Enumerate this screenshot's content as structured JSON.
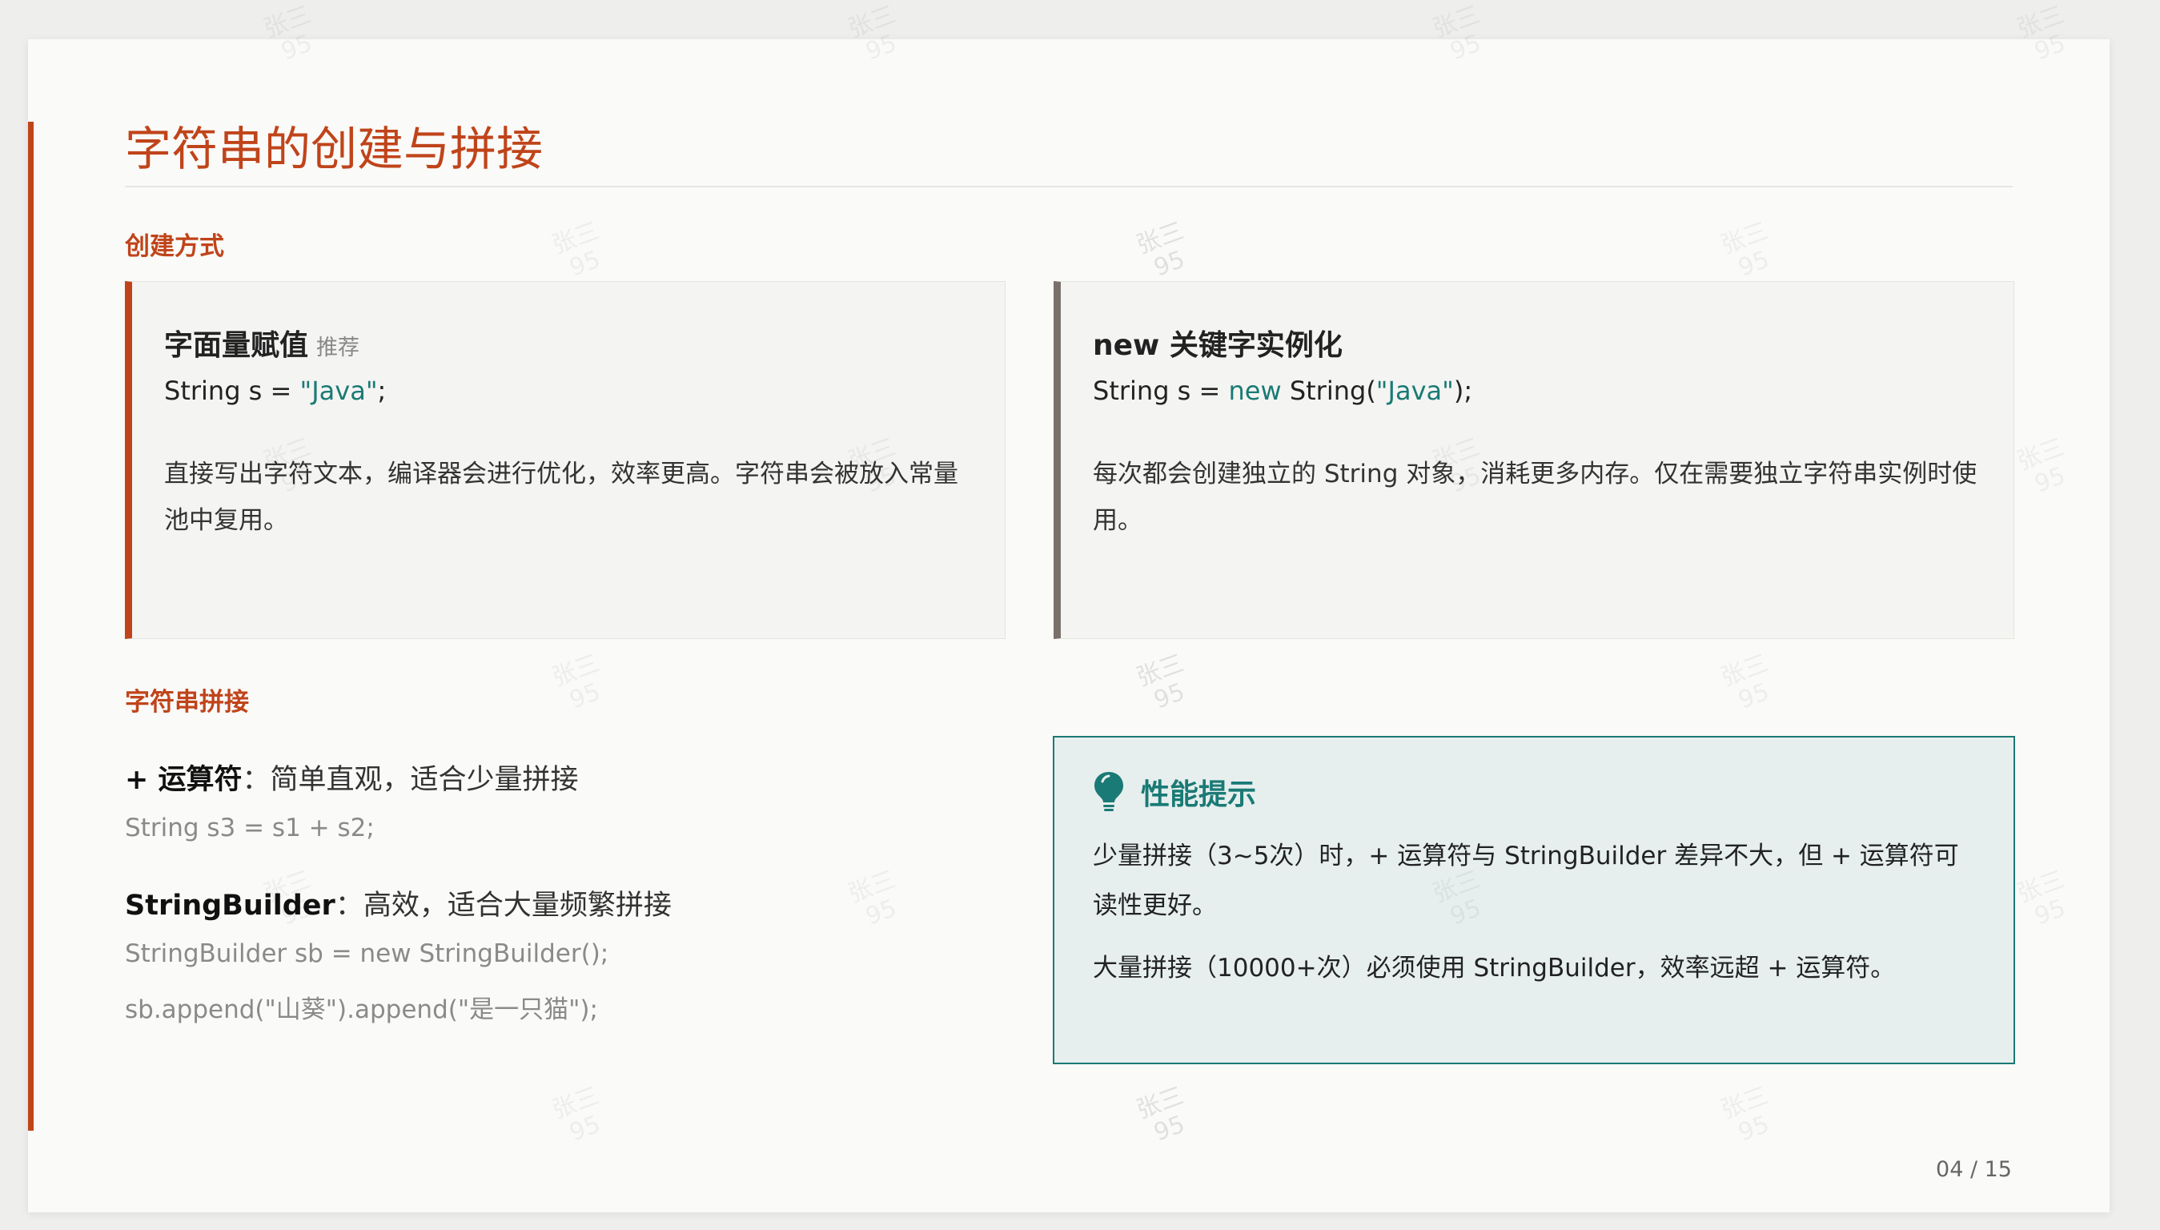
{
  "slide": {
    "title": "字符串的创建与拼接",
    "creation_heading": "创建方式",
    "cards": [
      {
        "title": "字面量赋值",
        "tag": "推荐",
        "code_prefix": "String s = ",
        "code_keyword": "",
        "code_middle": "",
        "code_string": "\"Java\"",
        "code_suffix": ";",
        "description": "直接写出字符文本，编译器会进行优化，效率更高。字符串会被放入常量池中复用。"
      },
      {
        "title": "new 关键字实例化",
        "tag": "",
        "code_prefix": "String s = ",
        "code_keyword": "new",
        "code_middle": " String(",
        "code_string": "\"Java\"",
        "code_suffix": ");",
        "description": "每次都会创建独立的 String 对象，消耗更多内存。仅在需要独立字符串实例时使用。"
      }
    ],
    "concat_heading": "字符串拼接",
    "concat_items": [
      {
        "label": "+ 运算符",
        "text": "：简单直观，适合少量拼接",
        "code": [
          "String s3 = s1 + s2;"
        ]
      },
      {
        "label": "StringBuilder",
        "text": "：高效，适合大量频繁拼接",
        "code": [
          "StringBuilder sb = new StringBuilder();",
          "sb.append(\"山葵\").append(\"是一只猫\");"
        ]
      }
    ],
    "tip": {
      "icon": "lightbulb-icon",
      "title": "性能提示",
      "paragraphs": [
        "少量拼接（3~5次）时，+ 运算符与 StringBuilder 差异不大，但 + 运算符可读性更好。",
        "大量拼接（10000+次）必须使用 StringBuilder，效率远超 + 运算符。"
      ]
    },
    "page_number": "04 / 15",
    "watermark": {
      "name": "张三",
      "number": "95"
    }
  },
  "colors": {
    "accent": "#c0441a",
    "teal": "#1a7a75",
    "card_border_dark": "#7a706a",
    "background": "#fafaf8"
  }
}
